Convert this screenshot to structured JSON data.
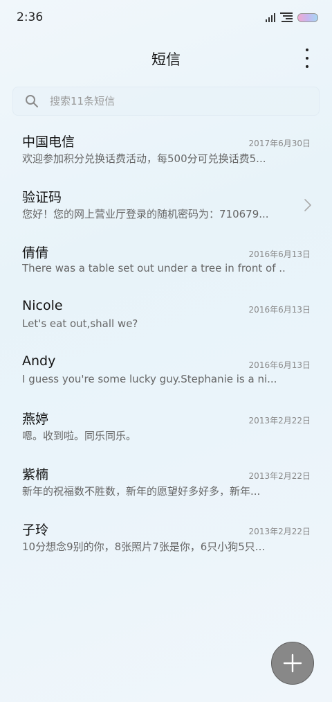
{
  "status_bar": {
    "time": "2:36",
    "icons": [
      "signal-icon",
      "wifi-icon",
      "battery-icon"
    ]
  },
  "header": {
    "title": "短信",
    "menu_icon": "more-vertical-icon"
  },
  "search": {
    "placeholder": "搜索11条短信",
    "icon": "search-icon"
  },
  "conversations": [
    {
      "name": "中国电信",
      "date": "2017年6月30日",
      "preview": "欢迎参加积分兑换话费活动，每500分可兑换话费5..."
    },
    {
      "name": "验证码",
      "date": "",
      "preview": "您好！您的网上营业厅登录的随机密码为：710679...",
      "trailing_icon": "chevron-right-icon"
    },
    {
      "name": "倩倩",
      "date": "2016年6月13日",
      "preview": "There was a table set out under a tree in front of ..."
    },
    {
      "name": "Nicole",
      "date": "2016年6月13日",
      "preview": "Let's eat out,shall we?"
    },
    {
      "name": "Andy",
      "date": "2016年6月13日",
      "preview": "I guess you're some lucky guy.Stephanie is a ni..."
    },
    {
      "name": "燕婷",
      "date": "2013年2月22日",
      "preview": "嗯。收到啦。同乐同乐。"
    },
    {
      "name": "紫楠",
      "date": "2013年2月22日",
      "preview": "新年的祝福数不胜数，新年的愿望好多好多，新年..."
    },
    {
      "name": "子玲",
      "date": "2013年2月22日",
      "preview": "10分想念9别的你，8张照片7张是你，6只小狗5只..."
    }
  ],
  "fab": {
    "icon": "plus-icon",
    "color": "#888888"
  },
  "colors": {
    "background": "#eaf4fa",
    "title_text": "#111111",
    "secondary_text": "#666666",
    "date_text": "#888888"
  }
}
